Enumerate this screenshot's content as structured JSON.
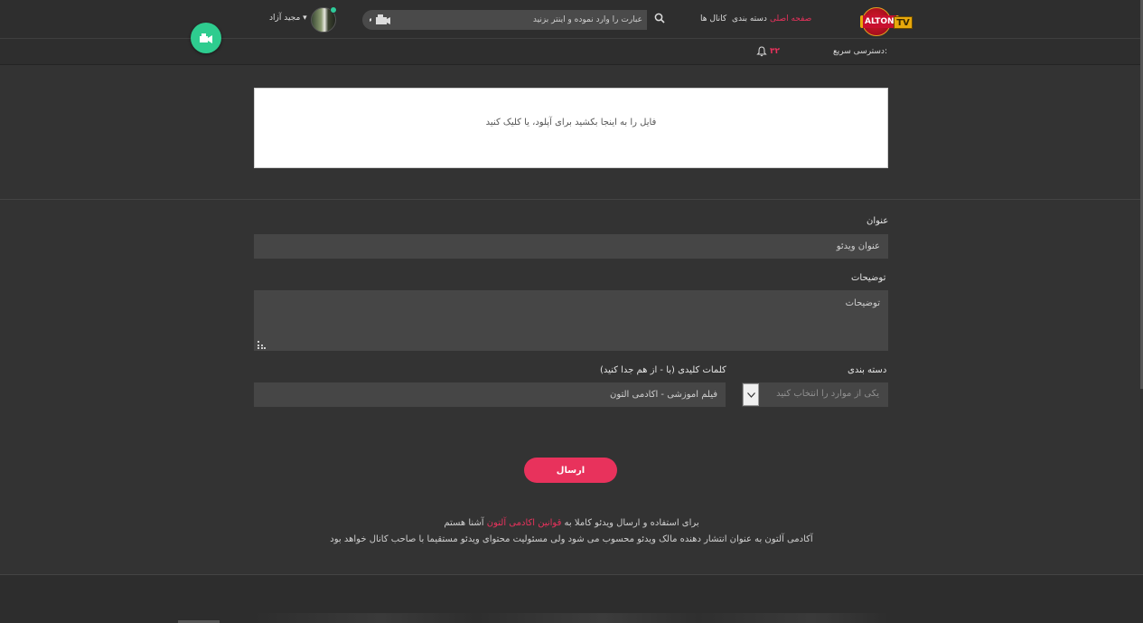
{
  "header": {
    "logo_text": "ALTON",
    "logo_tv": "TV",
    "nav": {
      "home": "صفحه اصلی",
      "categories": "دسته بندی",
      "channels": "کانال ها"
    },
    "search_placeholder": "عبارت را وارد نموده و اینتر بزنید",
    "user_name": "مجید آزاد",
    "user_dropdown_glyph": "▾"
  },
  "quickbar": {
    "label": "دسترسی سریع:",
    "notification_count": "۳۲"
  },
  "dropzone": {
    "text": "فایل را به اینجا بکشید برای آپلود، یا کلیک کنید"
  },
  "form": {
    "title_label": "عنوان",
    "title_placeholder": "عنوان ویدئو",
    "description_label": "توضیحات",
    "description_placeholder": "توضیحات",
    "category_label": "دسته بندی",
    "category_selected": "یکی از موارد را انتخاب کنید",
    "keywords_label": "کلمات کلیدی (با - از هم جدا کنید)",
    "keywords_value": "فیلم آموزشی - آکادمی آلتون",
    "submit_label": "ارسال"
  },
  "terms": {
    "line1_prefix": "برای استفاده و ارسال ویدئو کاملا به ",
    "line1_link": "قوانین اکادمی آلتون",
    "line1_suffix": " آشنا هستم",
    "line2": "آکادمی آلتون به عنوان انتشار دهنده مالک ویدئو محسوب می شود ولی مسئولیت محتوای ویدئو مستقیما با صاحب کانال خواهد بود"
  },
  "colors": {
    "accent": "#e8325c",
    "upload_fab": "#2ecc8f",
    "background": "#333333"
  },
  "icons": [
    "search-icon",
    "video-camera-icon",
    "bell-icon",
    "upload-icon",
    "chevron-down-icon",
    "resize-grip-icon"
  ]
}
